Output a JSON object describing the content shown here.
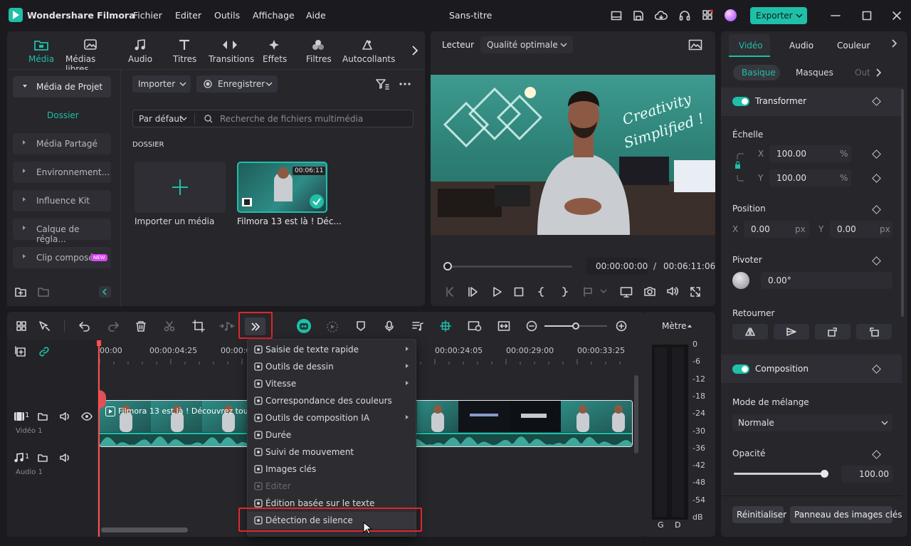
{
  "app": {
    "name": "Wondershare Filmora",
    "doc_title": "Sans-titre",
    "export_label": "Exporter"
  },
  "menu": [
    "Fichier",
    "Edit​er",
    "Outils",
    "Affichage",
    "Aide"
  ],
  "media_tabs": [
    "Média",
    "Médias libres",
    "Audio",
    "Titres",
    "Transitions",
    "Effets",
    "Filtres",
    "Autocollants"
  ],
  "sidebar": {
    "project_media": "Média de Projet",
    "folder": "Dossier",
    "items": [
      "Média Partagé",
      "Environnement...",
      "Influence Kit",
      "Calque de régla...",
      "Clip composé"
    ],
    "new_badge": "NEW"
  },
  "library": {
    "import_label": "Importer",
    "record_label": "Enregistrer",
    "sort_label": "Par défaut",
    "search_placeholder": "Recherche de fichiers multimédia",
    "section": "DOSSIER",
    "import_media": "Importer un média",
    "clip_name": "Filmora 13 est là ! Déc...",
    "clip_duration": "00:06:11"
  },
  "player": {
    "label": "Lecteur",
    "quality": "Qualité optimale",
    "current_time": "00:00:00:00",
    "separator": "/",
    "total_time": "00:06:11:06",
    "neon_line1": "Creativity",
    "neon_line2": "Simplified !"
  },
  "props": {
    "tabs": [
      "Vidéo",
      "Audio",
      "Couleur"
    ],
    "subtabs": [
      "Basique",
      "Masques",
      "Out"
    ],
    "transform": "Transformer",
    "scale": "Échelle",
    "x_label": "X",
    "y_label": "Y",
    "scale_x": "100.00",
    "scale_y": "100.00",
    "pct": "%",
    "position": "Position",
    "pos_x": "0.00",
    "pos_y": "0.00",
    "px": "px",
    "rotate": "Pivoter",
    "rotate_val": "0.00°",
    "flip": "Retourner",
    "composition": "Composition",
    "blend_mode_label": "Mode de mélange",
    "blend_mode": "Normale",
    "opacity_label": "Opacité",
    "opacity": "100.00",
    "opacity_level": 1.0,
    "reset": "Réinitialiser",
    "keyframe_panel": "Panneau des images clés"
  },
  "timeline": {
    "ruler": [
      "00:00",
      "00:00:04:25",
      "00:00:0",
      "00:00:24:05",
      "00:00:29:00",
      "00:00:33:25"
    ],
    "video_track": "Vidéo 1",
    "audio_track": "Audio 1",
    "track_num": "1",
    "clip_title": "Filmora 13 est là ! Découvrez toute",
    "meter_label": "Mètre",
    "meter_scale": [
      "0",
      "-6",
      "-12",
      "-18",
      "-24",
      "-30",
      "-36",
      "-42",
      "-48",
      "-54",
      "dB"
    ],
    "meter_channels": [
      "G",
      "D"
    ]
  },
  "context_menu": [
    {
      "label": "Saisie de texte rapide",
      "submenu": true,
      "enabled": true
    },
    {
      "label": "Outils de dessin",
      "submenu": true,
      "enabled": true
    },
    {
      "label": "Vitesse",
      "submenu": true,
      "enabled": true
    },
    {
      "label": "Correspondance des couleurs",
      "submenu": false,
      "enabled": true
    },
    {
      "label": "Outils de composition IA",
      "submenu": true,
      "enabled": true
    },
    {
      "label": "Durée",
      "submenu": false,
      "enabled": true
    },
    {
      "label": "Suivi de mouvement",
      "submenu": false,
      "enabled": true
    },
    {
      "label": "Images clés",
      "submenu": false,
      "enabled": true
    },
    {
      "label": "Editer",
      "submenu": false,
      "enabled": false
    },
    {
      "label": "Édition basée sur le texte",
      "submenu": false,
      "enabled": true
    },
    {
      "label": "Détection de silence",
      "submenu": false,
      "enabled": true
    }
  ],
  "colors": {
    "accent": "#1fbfa8",
    "highlight": "#e0262b",
    "new_badge": "#d946ef"
  }
}
